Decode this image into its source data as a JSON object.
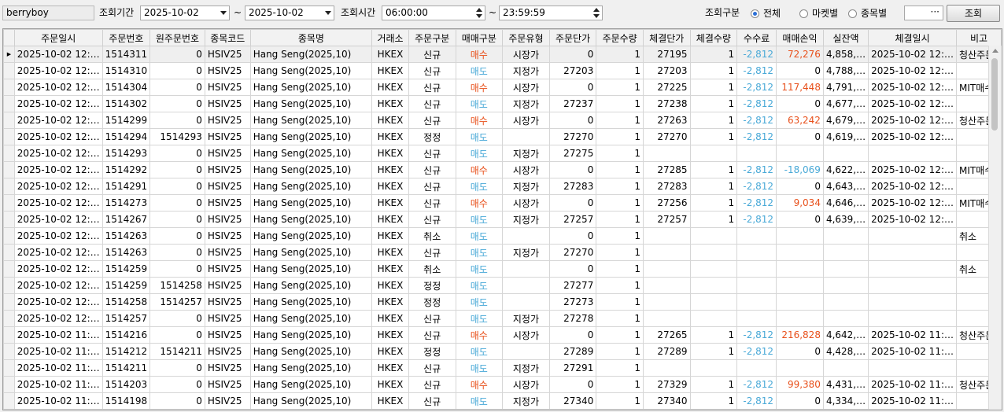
{
  "toolbar": {
    "user": "berryboy",
    "period_label": "조회기간",
    "date_from": "2025-10-02",
    "tilde": "~",
    "date_to": "2025-10-02",
    "time_label": "조회시간",
    "time_from": "06:00:00",
    "time_to": "23:59:59",
    "type_label": "조회구분",
    "radio_all": "전체",
    "radio_market": "마켓별",
    "radio_symbol": "종목별",
    "code_value": "···",
    "search_button": "조회"
  },
  "columns": [
    "주문일시",
    "주문번호",
    "원주문번호",
    "종목코드",
    "종목명",
    "거래소",
    "주문구분",
    "매매구분",
    "주문유형",
    "주문단가",
    "주문수량",
    "체결단가",
    "체결수량",
    "수수료",
    "매매손익",
    "실잔액",
    "체결일시",
    "비고"
  ],
  "rows": [
    [
      "2025-10-02 12:…",
      "1514311",
      "0",
      "HSIV25",
      "Hang Seng(2025,10)",
      "HKEX",
      "신규",
      "매수",
      "시장가",
      "0",
      "1",
      "27195",
      "1",
      "-2,812",
      "72,276",
      "4,858,…",
      "2025-10-02 12:…",
      "청산주문"
    ],
    [
      "2025-10-02 12:…",
      "1514310",
      "0",
      "HSIV25",
      "Hang Seng(2025,10)",
      "HKEX",
      "신규",
      "매도",
      "지정가",
      "27203",
      "1",
      "27203",
      "1",
      "-2,812",
      "0",
      "4,788,…",
      "2025-10-02 12:…",
      ""
    ],
    [
      "2025-10-02 12:…",
      "1514304",
      "0",
      "HSIV25",
      "Hang Seng(2025,10)",
      "HKEX",
      "신규",
      "매수",
      "시장가",
      "0",
      "1",
      "27225",
      "1",
      "-2,812",
      "117,448",
      "4,791,…",
      "2025-10-02 12:…",
      "MIT매수"
    ],
    [
      "2025-10-02 12:…",
      "1514302",
      "0",
      "HSIV25",
      "Hang Seng(2025,10)",
      "HKEX",
      "신규",
      "매도",
      "지정가",
      "27237",
      "1",
      "27238",
      "1",
      "-2,812",
      "0",
      "4,677,…",
      "2025-10-02 12:…",
      ""
    ],
    [
      "2025-10-02 12:…",
      "1514299",
      "0",
      "HSIV25",
      "Hang Seng(2025,10)",
      "HKEX",
      "신규",
      "매수",
      "시장가",
      "0",
      "1",
      "27263",
      "1",
      "-2,812",
      "63,242",
      "4,679,…",
      "2025-10-02 12:…",
      "청산주문"
    ],
    [
      "2025-10-02 12:…",
      "1514294",
      "1514293",
      "HSIV25",
      "Hang Seng(2025,10)",
      "HKEX",
      "정정",
      "매도",
      "",
      "27270",
      "1",
      "27270",
      "1",
      "-2,812",
      "0",
      "4,619,…",
      "2025-10-02 12:…",
      ""
    ],
    [
      "2025-10-02 12:…",
      "1514293",
      "0",
      "HSIV25",
      "Hang Seng(2025,10)",
      "HKEX",
      "신규",
      "매도",
      "지정가",
      "27275",
      "1",
      "",
      "",
      "",
      "",
      "",
      "",
      ""
    ],
    [
      "2025-10-02 12:…",
      "1514292",
      "0",
      "HSIV25",
      "Hang Seng(2025,10)",
      "HKEX",
      "신규",
      "매수",
      "시장가",
      "0",
      "1",
      "27285",
      "1",
      "-2,812",
      "-18,069",
      "4,622,…",
      "2025-10-02 12:…",
      "MIT매수"
    ],
    [
      "2025-10-02 12:…",
      "1514291",
      "0",
      "HSIV25",
      "Hang Seng(2025,10)",
      "HKEX",
      "신규",
      "매도",
      "지정가",
      "27283",
      "1",
      "27283",
      "1",
      "-2,812",
      "0",
      "4,643,…",
      "2025-10-02 12:…",
      ""
    ],
    [
      "2025-10-02 12:…",
      "1514273",
      "0",
      "HSIV25",
      "Hang Seng(2025,10)",
      "HKEX",
      "신규",
      "매수",
      "시장가",
      "0",
      "1",
      "27256",
      "1",
      "-2,812",
      "9,034",
      "4,646,…",
      "2025-10-02 12:…",
      "MIT매수"
    ],
    [
      "2025-10-02 12:…",
      "1514267",
      "0",
      "HSIV25",
      "Hang Seng(2025,10)",
      "HKEX",
      "신규",
      "매도",
      "지정가",
      "27257",
      "1",
      "27257",
      "1",
      "-2,812",
      "0",
      "4,639,…",
      "2025-10-02 12:…",
      ""
    ],
    [
      "2025-10-02 12:…",
      "1514263",
      "0",
      "HSIV25",
      "Hang Seng(2025,10)",
      "HKEX",
      "취소",
      "매도",
      "",
      "0",
      "1",
      "",
      "",
      "",
      "",
      "",
      "",
      "취소"
    ],
    [
      "2025-10-02 12:…",
      "1514263",
      "0",
      "HSIV25",
      "Hang Seng(2025,10)",
      "HKEX",
      "신규",
      "매도",
      "지정가",
      "27270",
      "1",
      "",
      "",
      "",
      "",
      "",
      "",
      ""
    ],
    [
      "2025-10-02 12:…",
      "1514259",
      "0",
      "HSIV25",
      "Hang Seng(2025,10)",
      "HKEX",
      "취소",
      "매도",
      "",
      "0",
      "1",
      "",
      "",
      "",
      "",
      "",
      "",
      "취소"
    ],
    [
      "2025-10-02 12:…",
      "1514259",
      "1514258",
      "HSIV25",
      "Hang Seng(2025,10)",
      "HKEX",
      "정정",
      "매도",
      "",
      "27277",
      "1",
      "",
      "",
      "",
      "",
      "",
      "",
      ""
    ],
    [
      "2025-10-02 12:…",
      "1514258",
      "1514257",
      "HSIV25",
      "Hang Seng(2025,10)",
      "HKEX",
      "정정",
      "매도",
      "",
      "27273",
      "1",
      "",
      "",
      "",
      "",
      "",
      "",
      ""
    ],
    [
      "2025-10-02 12:…",
      "1514257",
      "0",
      "HSIV25",
      "Hang Seng(2025,10)",
      "HKEX",
      "신규",
      "매도",
      "지정가",
      "27278",
      "1",
      "",
      "",
      "",
      "",
      "",
      "",
      ""
    ],
    [
      "2025-10-02 11:…",
      "1514216",
      "0",
      "HSIV25",
      "Hang Seng(2025,10)",
      "HKEX",
      "신규",
      "매수",
      "시장가",
      "0",
      "1",
      "27265",
      "1",
      "-2,812",
      "216,828",
      "4,642,…",
      "2025-10-02 11:…",
      "청산주문"
    ],
    [
      "2025-10-02 11:…",
      "1514212",
      "1514211",
      "HSIV25",
      "Hang Seng(2025,10)",
      "HKEX",
      "정정",
      "매도",
      "",
      "27289",
      "1",
      "27289",
      "1",
      "-2,812",
      "0",
      "4,428,…",
      "2025-10-02 11:…",
      ""
    ],
    [
      "2025-10-02 11:…",
      "1514211",
      "0",
      "HSIV25",
      "Hang Seng(2025,10)",
      "HKEX",
      "신규",
      "매도",
      "지정가",
      "27291",
      "1",
      "",
      "",
      "",
      "",
      "",
      "",
      ""
    ],
    [
      "2025-10-02 11:…",
      "1514203",
      "0",
      "HSIV25",
      "Hang Seng(2025,10)",
      "HKEX",
      "신규",
      "매수",
      "시장가",
      "0",
      "1",
      "27329",
      "1",
      "-2,812",
      "99,380",
      "4,431,…",
      "2025-10-02 11:…",
      "청산주문"
    ],
    [
      "2025-10-02 11:…",
      "1514198",
      "0",
      "HSIV25",
      "Hang Seng(2025,10)",
      "HKEX",
      "신규",
      "매도",
      "지정가",
      "27340",
      "1",
      "27340",
      "1",
      "-2,812",
      "0",
      "4,334,…",
      "2025-10-02 11:…",
      ""
    ]
  ],
  "colors": {
    "buy": "#e8501b",
    "sell": "#49a9d7",
    "profit": "#e8501b",
    "loss": "#49a9d7"
  },
  "icons": {
    "row_pointer": "triangle-right-icon",
    "dropdown": "chevron-down-icon",
    "spinner": "spin-updown-icon"
  }
}
